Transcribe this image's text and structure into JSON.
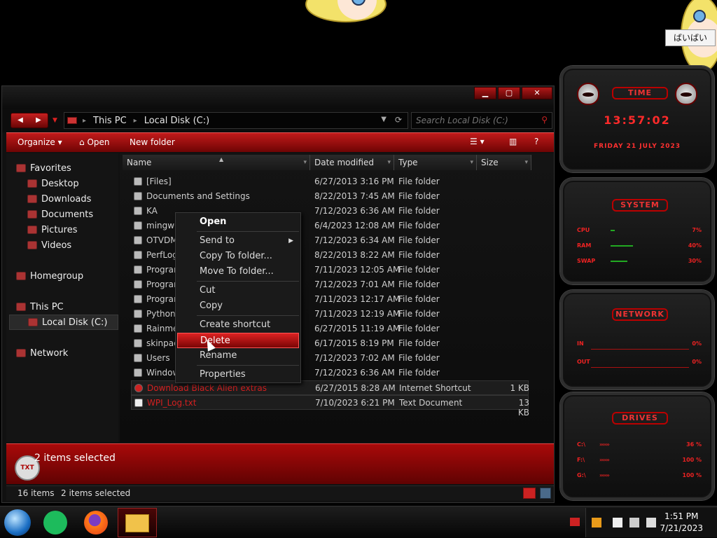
{
  "desktop": {
    "note_text": "ばいばい"
  },
  "window": {
    "buttons": {
      "minimize": "▁",
      "maximize": "▢",
      "close": "✕"
    }
  },
  "address": {
    "crumbs": [
      "This PC",
      "Local Disk (C:)"
    ],
    "search_placeholder": "Search Local Disk (C:)"
  },
  "toolbar": {
    "organize": "Organize",
    "open": "Open",
    "new_folder": "New folder"
  },
  "sidebar": {
    "items": [
      {
        "label": "Favorites"
      },
      {
        "label": "Desktop"
      },
      {
        "label": "Downloads"
      },
      {
        "label": "Documents"
      },
      {
        "label": "Pictures"
      },
      {
        "label": "Videos"
      },
      {
        "label": "Homegroup"
      },
      {
        "label": "This PC"
      },
      {
        "label": "Local Disk (C:)"
      },
      {
        "label": "Network"
      }
    ]
  },
  "columns": [
    "Name",
    "Date modified",
    "Type",
    "Size"
  ],
  "files": [
    {
      "name": "[Files]",
      "date": "6/27/2013 3:16 PM",
      "type": "File folder",
      "size": ""
    },
    {
      "name": "Documents and Settings",
      "date": "8/22/2013 7:45 AM",
      "type": "File folder",
      "size": ""
    },
    {
      "name": "KA",
      "date": "7/12/2023 6:36 AM",
      "type": "File folder",
      "size": ""
    },
    {
      "name": "mingw64",
      "date": "6/4/2023 12:08 AM",
      "type": "File folder",
      "size": ""
    },
    {
      "name": "OTVDM",
      "date": "7/12/2023 6:34 AM",
      "type": "File folder",
      "size": ""
    },
    {
      "name": "PerfLogs",
      "date": "8/22/2013 8:22 AM",
      "type": "File folder",
      "size": ""
    },
    {
      "name": "Program",
      "date": "7/11/2023 12:05 AM",
      "type": "File folder",
      "size": ""
    },
    {
      "name": "Program",
      "date": "7/12/2023 7:01 AM",
      "type": "File folder",
      "size": ""
    },
    {
      "name": "Program",
      "date": "7/11/2023 12:17 AM",
      "type": "File folder",
      "size": ""
    },
    {
      "name": "Python27",
      "date": "7/11/2023 12:19 AM",
      "type": "File folder",
      "size": ""
    },
    {
      "name": "Rainmete",
      "date": "6/27/2015 11:19 AM",
      "type": "File folder",
      "size": ""
    },
    {
      "name": "skinpack",
      "date": "6/17/2015 8:19 PM",
      "type": "File folder",
      "size": ""
    },
    {
      "name": "Users",
      "date": "7/12/2023 7:02 AM",
      "type": "File folder",
      "size": ""
    },
    {
      "name": "Windows",
      "date": "7/12/2023 6:36 AM",
      "type": "File folder",
      "size": ""
    },
    {
      "name": "Download Black Alien extras",
      "date": "6/27/2015 8:28 AM",
      "type": "Internet Shortcut",
      "size": "1 KB"
    },
    {
      "name": "WPI_Log.txt",
      "date": "7/10/2023 6:21 PM",
      "type": "Text Document",
      "size": "13 KB"
    }
  ],
  "context_menu": {
    "open": "Open",
    "send_to": "Send to",
    "copy_to": "Copy To folder...",
    "move_to": "Move To folder...",
    "cut": "Cut",
    "copy": "Copy",
    "create_shortcut": "Create shortcut",
    "delete": "Delete",
    "rename": "Rename",
    "properties": "Properties"
  },
  "details": {
    "thumb_label": "TXT",
    "text": "2 items selected"
  },
  "status": {
    "count": "16 items",
    "selected": "2 items selected"
  },
  "gadgets": {
    "time": {
      "title": "TIME",
      "clock": "13:57:02",
      "date": "FRIDAY 21 JULY 2023"
    },
    "system": {
      "title": "SYSTEM",
      "rows": [
        {
          "label": "CPU",
          "value": "7%",
          "level": 0.07
        },
        {
          "label": "RAM",
          "value": "40%",
          "level": 0.4
        },
        {
          "label": "SWAP",
          "value": "30%",
          "level": 0.3
        }
      ]
    },
    "network": {
      "title": "NETWORK",
      "rows": [
        {
          "label": "IN",
          "value": "0%"
        },
        {
          "label": "OUT",
          "value": "0%"
        }
      ]
    },
    "drives": {
      "title": "DRIVES",
      "rows": [
        {
          "label": "C:\\",
          "value": "36 %"
        },
        {
          "label": "F:\\",
          "value": "100 %"
        },
        {
          "label": "G:\\",
          "value": "100 %"
        }
      ]
    }
  },
  "taskbar": {
    "clock_time": "1:51 PM",
    "clock_date": "7/21/2023"
  },
  "colors": {
    "accent": "#c21a1a",
    "accent_dark": "#6e0404",
    "gadget_text": "#ff2a2a"
  }
}
